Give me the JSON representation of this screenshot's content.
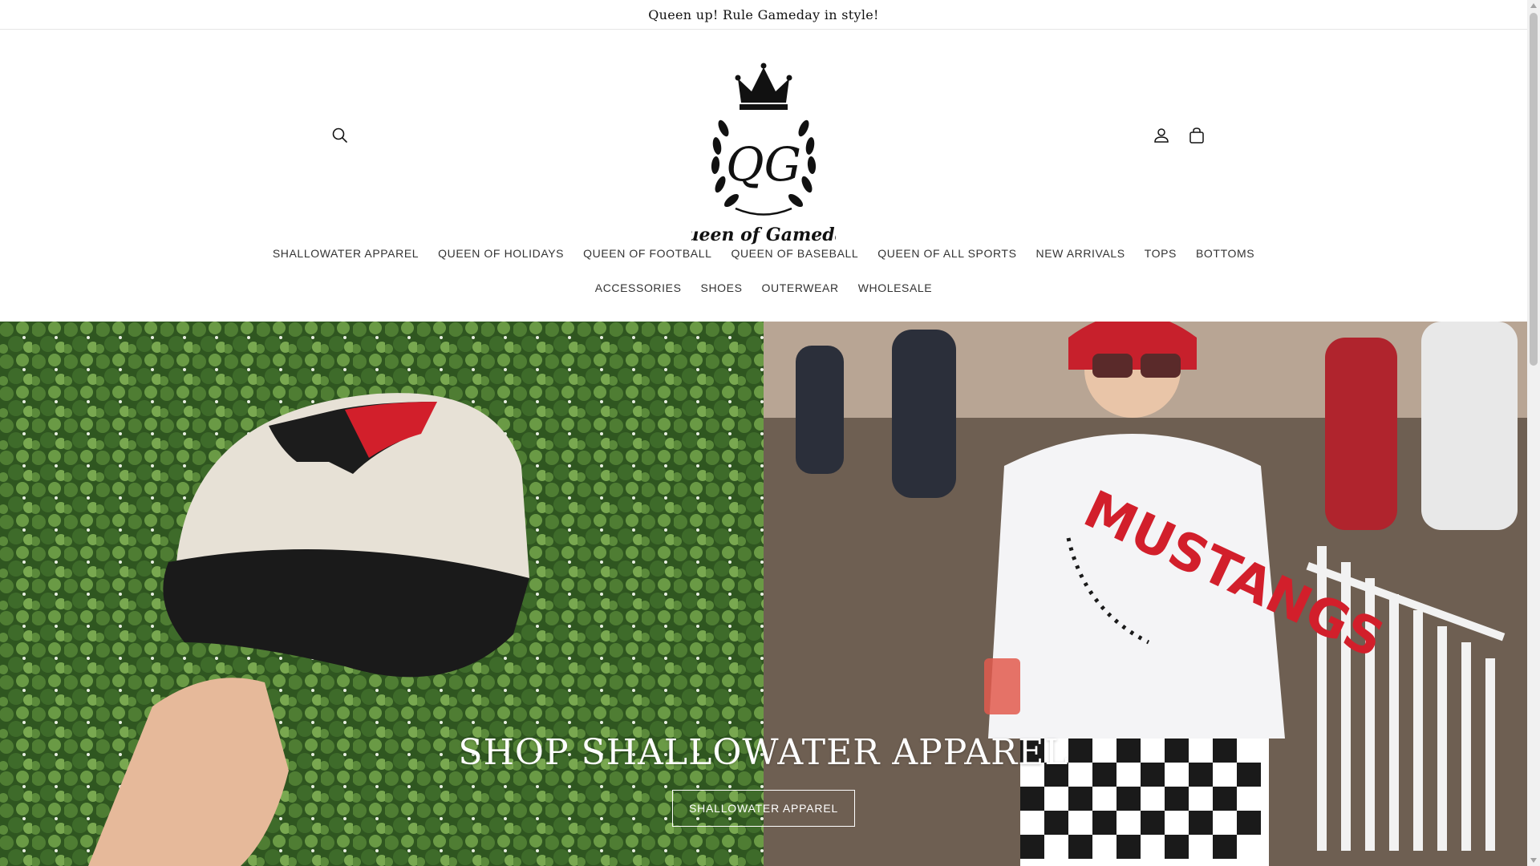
{
  "announcement": {
    "text": "Queen up! Rule Gameday in style!"
  },
  "header": {
    "logo_text": "Queen of Gameday",
    "logo_monogram": "QG",
    "icons": {
      "search": "search-icon",
      "account": "account-icon",
      "cart": "cart-icon"
    }
  },
  "nav": {
    "row1": [
      "SHALLOWATER APPAREL",
      "QUEEN OF HOLIDAYS",
      "QUEEN OF FOOTBALL",
      "QUEEN OF BASEBALL",
      "QUEEN OF ALL SPORTS",
      "NEW ARRIVALS",
      "TOPS",
      "BOTTOMS"
    ],
    "row2": [
      "ACCESSORIES",
      "SHOES",
      "OUTERWEAR",
      "WHOLESALE"
    ]
  },
  "hero": {
    "title": "SHOP SHALLOWATER APPAREL",
    "button_label": "SHALLOWATER APPAREL",
    "sweatshirt_text": "MUSTANGS"
  },
  "colors": {
    "accent_red": "#d21f2b",
    "text": "#121212",
    "hedge_green": "#3f6a2a"
  }
}
